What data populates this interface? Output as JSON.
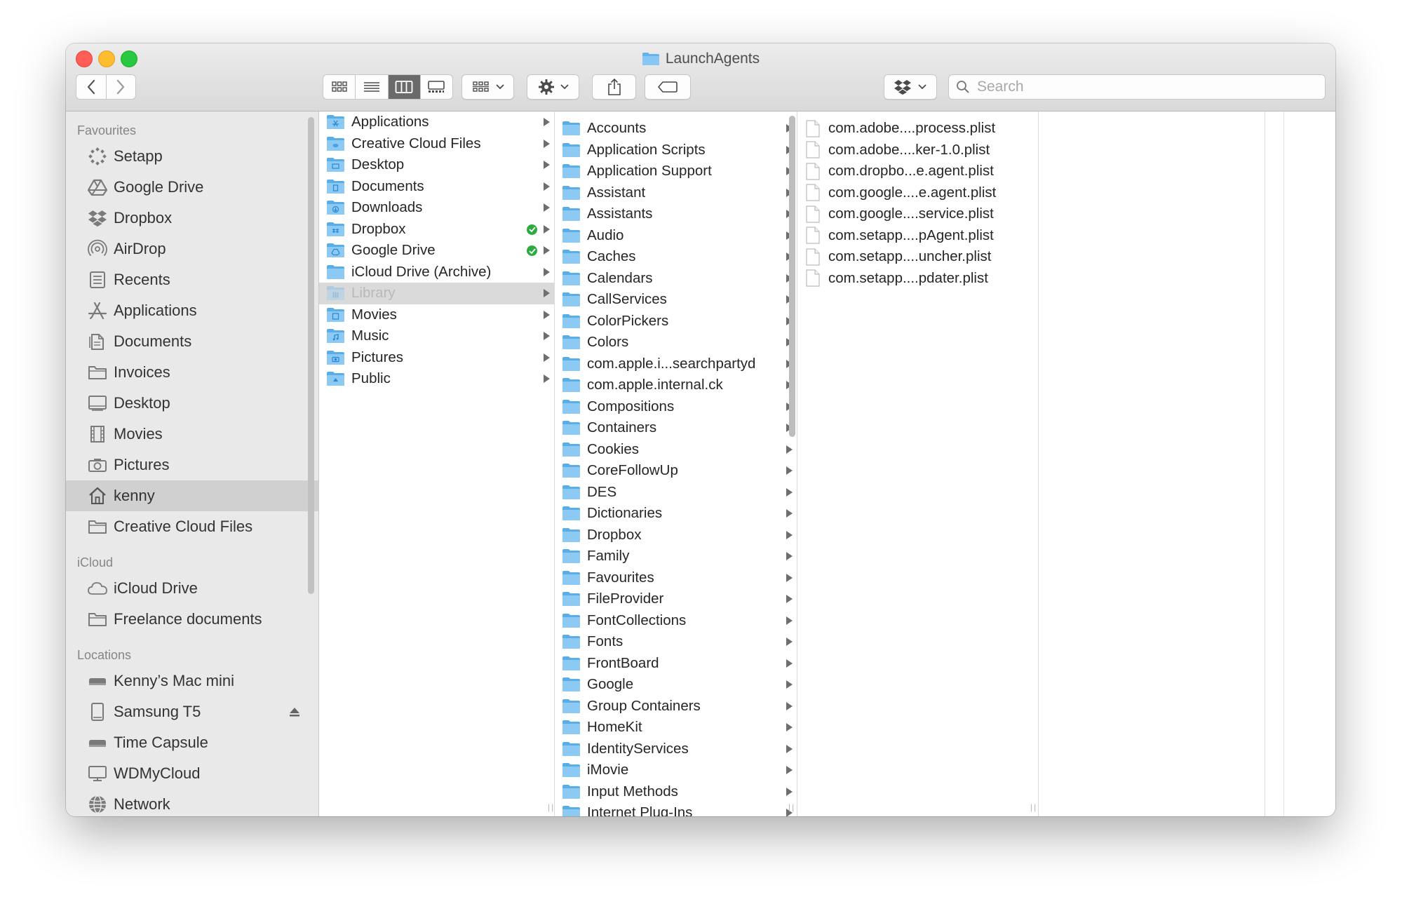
{
  "window": {
    "title": "LaunchAgents"
  },
  "toolbar": {
    "search_placeholder": "Search",
    "view_modes": [
      "icon-view",
      "list-view",
      "column-view",
      "gallery-view"
    ],
    "active_view": "column-view"
  },
  "sidebar": {
    "favourites_heading": "Favourites",
    "favourites": [
      {
        "label": "Setapp",
        "icon": "setapp-icon"
      },
      {
        "label": "Google Drive",
        "icon": "google-drive-icon"
      },
      {
        "label": "Dropbox",
        "icon": "dropbox-icon"
      },
      {
        "label": "AirDrop",
        "icon": "airdrop-icon"
      },
      {
        "label": "Recents",
        "icon": "recents-icon"
      },
      {
        "label": "Applications",
        "icon": "applications-icon"
      },
      {
        "label": "Documents",
        "icon": "documents-icon"
      },
      {
        "label": "Invoices",
        "icon": "folder-icon"
      },
      {
        "label": "Desktop",
        "icon": "desktop-icon"
      },
      {
        "label": "Movies",
        "icon": "movies-icon"
      },
      {
        "label": "Pictures",
        "icon": "pictures-icon"
      },
      {
        "label": "kenny",
        "icon": "home-icon",
        "selected": true
      },
      {
        "label": "Creative Cloud Files",
        "icon": "folder-icon"
      }
    ],
    "icloud_heading": "iCloud",
    "icloud": [
      {
        "label": "iCloud Drive",
        "icon": "cloud-icon"
      },
      {
        "label": "Freelance documents",
        "icon": "folder-icon"
      }
    ],
    "locations_heading": "Locations",
    "locations": [
      {
        "label": "Kenny’s Mac mini",
        "icon": "mac-mini-icon"
      },
      {
        "label": "Samsung T5",
        "icon": "external-drive-icon",
        "eject": true
      },
      {
        "label": "Time Capsule",
        "icon": "time-capsule-icon"
      },
      {
        "label": "WDMyCloud",
        "icon": "display-icon"
      },
      {
        "label": "Network",
        "icon": "network-icon"
      }
    ]
  },
  "column_home": [
    {
      "label": "Applications",
      "badge": "applications"
    },
    {
      "label": "Creative Cloud Files",
      "badge": "cloud"
    },
    {
      "label": "Desktop",
      "badge": "desktop"
    },
    {
      "label": "Documents",
      "badge": "documents"
    },
    {
      "label": "Downloads",
      "badge": "downloads"
    },
    {
      "label": "Dropbox",
      "badge": "dropbox",
      "synced": true
    },
    {
      "label": "Google Drive",
      "badge": "drive",
      "synced": true
    },
    {
      "label": "iCloud Drive (Archive)",
      "badge": ""
    },
    {
      "label": "Library",
      "badge": "library",
      "selected": true
    },
    {
      "label": "Movies",
      "badge": "movies"
    },
    {
      "label": "Music",
      "badge": "music"
    },
    {
      "label": "Pictures",
      "badge": "pictures"
    },
    {
      "label": "Public",
      "badge": "public"
    }
  ],
  "column_library": [
    "Accounts",
    "Application Scripts",
    "Application Support",
    "Assistant",
    "Assistants",
    "Audio",
    "Caches",
    "Calendars",
    "CallServices",
    "ColorPickers",
    "Colors",
    "com.apple.i...searchpartyd",
    "com.apple.internal.ck",
    "Compositions",
    "Containers",
    "Cookies",
    "CoreFollowUp",
    "DES",
    "Dictionaries",
    "Dropbox",
    "Family",
    "Favourites",
    "FileProvider",
    "FontCollections",
    "Fonts",
    "FrontBoard",
    "Google",
    "Group Containers",
    "HomeKit",
    "IdentityServices",
    "iMovie",
    "Input Methods",
    "Internet Plug-Ins"
  ],
  "column_launchagents": [
    "com.adobe....process.plist",
    "com.adobe....ker-1.0.plist",
    "com.dropbo...e.agent.plist",
    "com.google....e.agent.plist",
    "com.google....service.plist",
    "com.setapp....pAgent.plist",
    "com.setapp....uncher.plist",
    "com.setapp....pdater.plist"
  ]
}
